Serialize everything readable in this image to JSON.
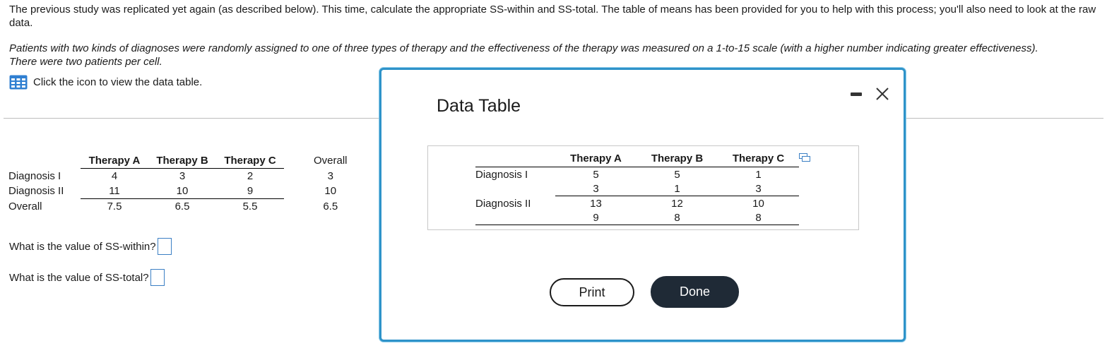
{
  "problem": {
    "intro": "The previous study was replicated yet again (as described below). This time, calculate the appropriate SS-within and SS-total. The table of means has been provided for you to help with this process; you'll also need to look at the raw data.",
    "scenario": "Patients with two kinds of diagnoses were randomly assigned to one of three types of therapy and the effectiveness of the therapy was measured on a 1-to-15 scale (with a higher number indicating greater effectiveness). There were two patients per cell.",
    "view_table_text": "Click the icon to view the data table."
  },
  "means_table": {
    "headers": [
      "Therapy A",
      "Therapy B",
      "Therapy C"
    ],
    "overall_header": "Overall",
    "rows": [
      {
        "label": "Diagnosis I",
        "values": [
          "4",
          "3",
          "2"
        ],
        "overall": "3"
      },
      {
        "label": "Diagnosis II",
        "values": [
          "11",
          "10",
          "9"
        ],
        "overall": "10"
      },
      {
        "label": "Overall",
        "values": [
          "7.5",
          "6.5",
          "5.5"
        ],
        "overall": "6.5"
      }
    ]
  },
  "questions": {
    "ss_within": {
      "label": "What is the value of SS-within?",
      "value": ""
    },
    "ss_total": {
      "label": "What is the value of SS-total?",
      "value": ""
    }
  },
  "modal": {
    "title": "Data Table",
    "table": {
      "headers": [
        "Therapy A",
        "Therapy B",
        "Therapy C"
      ],
      "groups": [
        {
          "label": "Diagnosis I",
          "rows": [
            [
              "5",
              "5",
              "1"
            ],
            [
              "3",
              "1",
              "3"
            ]
          ]
        },
        {
          "label": "Diagnosis II",
          "rows": [
            [
              "13",
              "12",
              "10"
            ],
            [
              "9",
              "8",
              "8"
            ]
          ]
        }
      ]
    },
    "print_label": "Print",
    "done_label": "Done"
  },
  "colors": {
    "modal_border": "#2e93c9",
    "done_button": "#1f2a36",
    "answer_box_border": "#3b7fc4",
    "table_icon": "#2f7fd1"
  },
  "icons": [
    "table-grid-icon",
    "minimize-icon",
    "close-icon",
    "popout-icon"
  ]
}
